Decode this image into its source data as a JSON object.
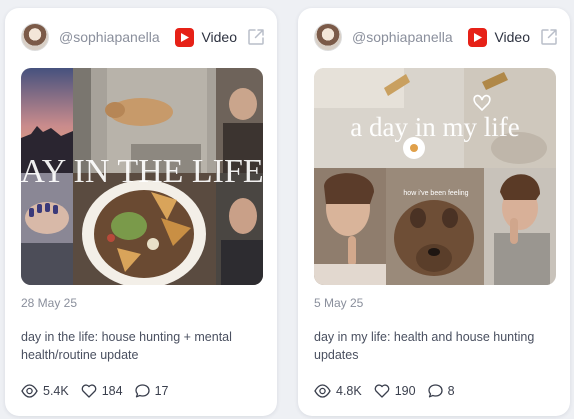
{
  "cards": [
    {
      "author": "@sophiapanella",
      "platform": "Video",
      "platform_icon": "youtube-icon",
      "overlay_text": "AY IN THE LIFE",
      "date": "28 May 25",
      "title": "day in the life: house hunting + mental health/routine update",
      "views": "5.4K",
      "likes": "184",
      "comments": "17"
    },
    {
      "author": "@sophiapanella",
      "platform": "Video",
      "platform_icon": "youtube-icon",
      "overlay_text": "a day in my life",
      "caption_text": "how i've been feeling",
      "date": "5 May 25",
      "title": "day in my life: health and house hunting updates",
      "views": "4.8K",
      "likes": "190",
      "comments": "8"
    }
  ],
  "colors": {
    "accent": "#e62117",
    "muted": "#8a8f9c",
    "text": "#4a5060"
  }
}
